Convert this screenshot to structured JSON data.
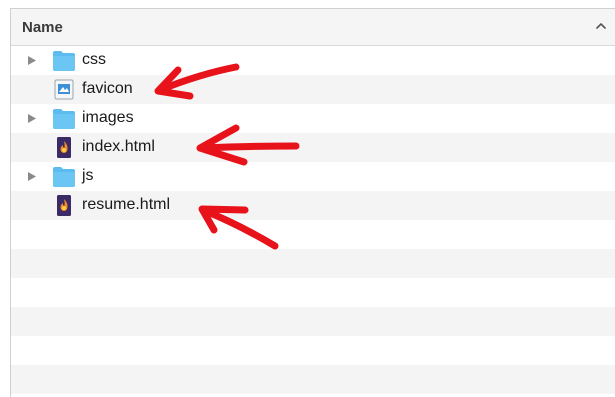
{
  "header": {
    "name_label": "Name"
  },
  "files": [
    {
      "name": "css",
      "kind": "folder",
      "expandable": true
    },
    {
      "name": "favicon",
      "kind": "image",
      "expandable": false
    },
    {
      "name": "images",
      "kind": "folder",
      "expandable": true
    },
    {
      "name": "index.html",
      "kind": "html",
      "expandable": false
    },
    {
      "name": "js",
      "kind": "folder",
      "expandable": true
    },
    {
      "name": "resume.html",
      "kind": "html",
      "expandable": false
    }
  ],
  "colors": {
    "folder": "#5bbcf0",
    "annotation_arrow": "#e8121b",
    "html_icon_bg": "#3a2a66",
    "html_icon_flame": "#f28c28"
  }
}
